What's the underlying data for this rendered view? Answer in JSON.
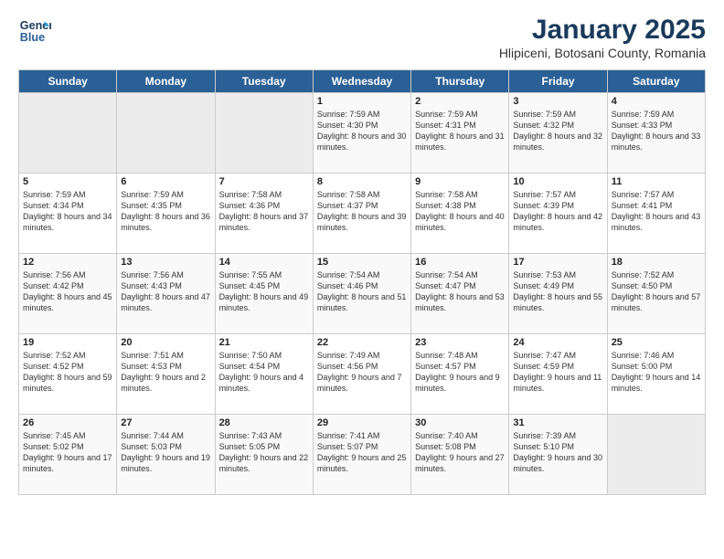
{
  "header": {
    "logo_line1": "General",
    "logo_line2": "Blue",
    "month": "January 2025",
    "location": "Hlipiceni, Botosani County, Romania"
  },
  "days_of_week": [
    "Sunday",
    "Monday",
    "Tuesday",
    "Wednesday",
    "Thursday",
    "Friday",
    "Saturday"
  ],
  "weeks": [
    [
      {
        "day": "",
        "empty": true
      },
      {
        "day": "",
        "empty": true
      },
      {
        "day": "",
        "empty": true
      },
      {
        "day": "1",
        "sunrise": "7:59 AM",
        "sunset": "4:30 PM",
        "daylight": "8 hours and 30 minutes."
      },
      {
        "day": "2",
        "sunrise": "7:59 AM",
        "sunset": "4:31 PM",
        "daylight": "8 hours and 31 minutes."
      },
      {
        "day": "3",
        "sunrise": "7:59 AM",
        "sunset": "4:32 PM",
        "daylight": "8 hours and 32 minutes."
      },
      {
        "day": "4",
        "sunrise": "7:59 AM",
        "sunset": "4:33 PM",
        "daylight": "8 hours and 33 minutes."
      }
    ],
    [
      {
        "day": "5",
        "sunrise": "7:59 AM",
        "sunset": "4:34 PM",
        "daylight": "8 hours and 34 minutes."
      },
      {
        "day": "6",
        "sunrise": "7:59 AM",
        "sunset": "4:35 PM",
        "daylight": "8 hours and 36 minutes."
      },
      {
        "day": "7",
        "sunrise": "7:58 AM",
        "sunset": "4:36 PM",
        "daylight": "8 hours and 37 minutes."
      },
      {
        "day": "8",
        "sunrise": "7:58 AM",
        "sunset": "4:37 PM",
        "daylight": "8 hours and 39 minutes."
      },
      {
        "day": "9",
        "sunrise": "7:58 AM",
        "sunset": "4:38 PM",
        "daylight": "8 hours and 40 minutes."
      },
      {
        "day": "10",
        "sunrise": "7:57 AM",
        "sunset": "4:39 PM",
        "daylight": "8 hours and 42 minutes."
      },
      {
        "day": "11",
        "sunrise": "7:57 AM",
        "sunset": "4:41 PM",
        "daylight": "8 hours and 43 minutes."
      }
    ],
    [
      {
        "day": "12",
        "sunrise": "7:56 AM",
        "sunset": "4:42 PM",
        "daylight": "8 hours and 45 minutes."
      },
      {
        "day": "13",
        "sunrise": "7:56 AM",
        "sunset": "4:43 PM",
        "daylight": "8 hours and 47 minutes."
      },
      {
        "day": "14",
        "sunrise": "7:55 AM",
        "sunset": "4:45 PM",
        "daylight": "8 hours and 49 minutes."
      },
      {
        "day": "15",
        "sunrise": "7:54 AM",
        "sunset": "4:46 PM",
        "daylight": "8 hours and 51 minutes."
      },
      {
        "day": "16",
        "sunrise": "7:54 AM",
        "sunset": "4:47 PM",
        "daylight": "8 hours and 53 minutes."
      },
      {
        "day": "17",
        "sunrise": "7:53 AM",
        "sunset": "4:49 PM",
        "daylight": "8 hours and 55 minutes."
      },
      {
        "day": "18",
        "sunrise": "7:52 AM",
        "sunset": "4:50 PM",
        "daylight": "8 hours and 57 minutes."
      }
    ],
    [
      {
        "day": "19",
        "sunrise": "7:52 AM",
        "sunset": "4:52 PM",
        "daylight": "8 hours and 59 minutes."
      },
      {
        "day": "20",
        "sunrise": "7:51 AM",
        "sunset": "4:53 PM",
        "daylight": "9 hours and 2 minutes."
      },
      {
        "day": "21",
        "sunrise": "7:50 AM",
        "sunset": "4:54 PM",
        "daylight": "9 hours and 4 minutes."
      },
      {
        "day": "22",
        "sunrise": "7:49 AM",
        "sunset": "4:56 PM",
        "daylight": "9 hours and 7 minutes."
      },
      {
        "day": "23",
        "sunrise": "7:48 AM",
        "sunset": "4:57 PM",
        "daylight": "9 hours and 9 minutes."
      },
      {
        "day": "24",
        "sunrise": "7:47 AM",
        "sunset": "4:59 PM",
        "daylight": "9 hours and 11 minutes."
      },
      {
        "day": "25",
        "sunrise": "7:46 AM",
        "sunset": "5:00 PM",
        "daylight": "9 hours and 14 minutes."
      }
    ],
    [
      {
        "day": "26",
        "sunrise": "7:45 AM",
        "sunset": "5:02 PM",
        "daylight": "9 hours and 17 minutes."
      },
      {
        "day": "27",
        "sunrise": "7:44 AM",
        "sunset": "5:03 PM",
        "daylight": "9 hours and 19 minutes."
      },
      {
        "day": "28",
        "sunrise": "7:43 AM",
        "sunset": "5:05 PM",
        "daylight": "9 hours and 22 minutes."
      },
      {
        "day": "29",
        "sunrise": "7:41 AM",
        "sunset": "5:07 PM",
        "daylight": "9 hours and 25 minutes."
      },
      {
        "day": "30",
        "sunrise": "7:40 AM",
        "sunset": "5:08 PM",
        "daylight": "9 hours and 27 minutes."
      },
      {
        "day": "31",
        "sunrise": "7:39 AM",
        "sunset": "5:10 PM",
        "daylight": "9 hours and 30 minutes."
      },
      {
        "day": "",
        "empty": true
      }
    ]
  ]
}
